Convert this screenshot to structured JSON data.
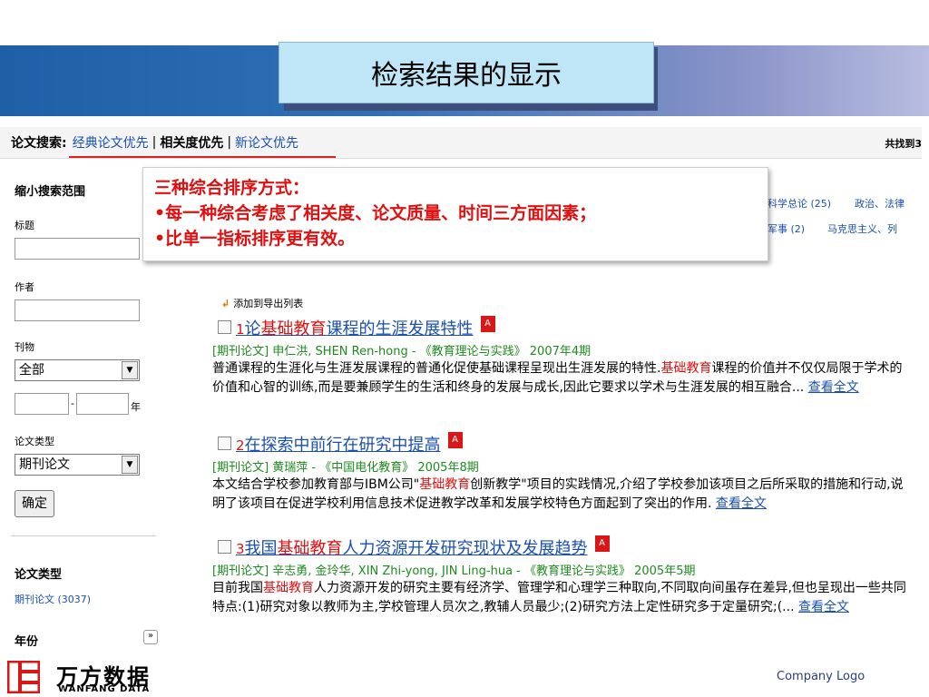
{
  "slide": {
    "title": "检索结果的显示",
    "company_logo": "Company Logo"
  },
  "sortbar": {
    "label": "论文搜索:",
    "opt1": "经典论文优先",
    "opt2": "相关度优先",
    "opt3": "新论文优先",
    "sep": "|",
    "found": "共找到3"
  },
  "sidebar": {
    "narrow_title": "缩小搜索范围",
    "title_label": "标题",
    "author_label": "作者",
    "journal_label": "刊物",
    "journal_value": "全部",
    "year_suffix": "年",
    "dash": "-",
    "type_label": "论文类型",
    "type_value": "期刊论文",
    "confirm": "确定",
    "section_type": "论文类型",
    "type_count": "期刊论文 (3037)",
    "section_year": "年份"
  },
  "callout": {
    "line1": "三种综合排序方式：",
    "line2": "•每一种综合考虑了相关度、论文质量、时间三方面因素；",
    "line3": "•比单一指标排序更有效。"
  },
  "categories": {
    "c1": "科学总论 (25)",
    "c2": "政治、法律",
    "c3": "军事 (2)",
    "c4": "马克思主义、列"
  },
  "results": {
    "add_to_export": "添加到导出列表",
    "more": "查看全文",
    "items": [
      {
        "num": "1",
        "title_pre": "论",
        "title_hl": "基础教育",
        "title_post": "课程的生涯发展特性",
        "meta": "[期刊论文]  申仁洪, SHEN Ren-hong - 《教育理论与实践》 2007年4期",
        "abs_a": "普通课程的生涯化与生涯发展课程的普通化促使基础课程呈现出生涯发展的特性.",
        "abs_hl": "基础教育",
        "abs_b": "课程的价值并不仅仅局限于学术的价值和心智的训练,而是要兼顾学生的生活和终身的发展与成长,因此它要求以学术与生涯发展的相互融合...",
        "pdf": "A"
      },
      {
        "num": "2",
        "title_pre": "在探索中前行在研究中提高",
        "title_hl": "",
        "title_post": "",
        "meta": "[期刊论文]  黄瑞萍 - 《中国电化教育》 2005年8期",
        "abs_a": "本文结合学校参加教育部与IBM公司\"",
        "abs_hl": "基础教育",
        "abs_b": "创新教学\"项目的实践情况,介绍了学校参加该项目之后所采取的措施和行动,说明了该项目在促进学校利用信息技术促进教学改革和发展学校特色方面起到了突出的作用.",
        "pdf": "A"
      },
      {
        "num": "3",
        "title_pre": "我国",
        "title_hl": "基础教育",
        "title_post": "人力资源开发研究现状及发展趋势",
        "meta": "[期刊论文]  辛志勇, 金玲华, XIN Zhi-yong, JIN Ling-hua - 《教育理论与实践》 2005年5期",
        "abs_a": "目前我国",
        "abs_hl": "基础教育",
        "abs_b": "人力资源开发的研究主要有经济学、管理学和心理学三种取向,不同取向间虽存在差异,但也呈现出一些共同特点:(1)研究对象以教师为主,学校管理人员次之,教辅人员最少;(2)研究方法上定性研究多于定量研究;(...",
        "pdf": "A"
      }
    ]
  },
  "brand": {
    "cn": "万方数据",
    "en": "WANFANG DATA"
  },
  "icons": {
    "pdf": "pdf-icon",
    "arrow": "arrow-down-left-icon",
    "dropdown": "chevron-down-icon",
    "collapse": "double-chevron-down-icon"
  }
}
